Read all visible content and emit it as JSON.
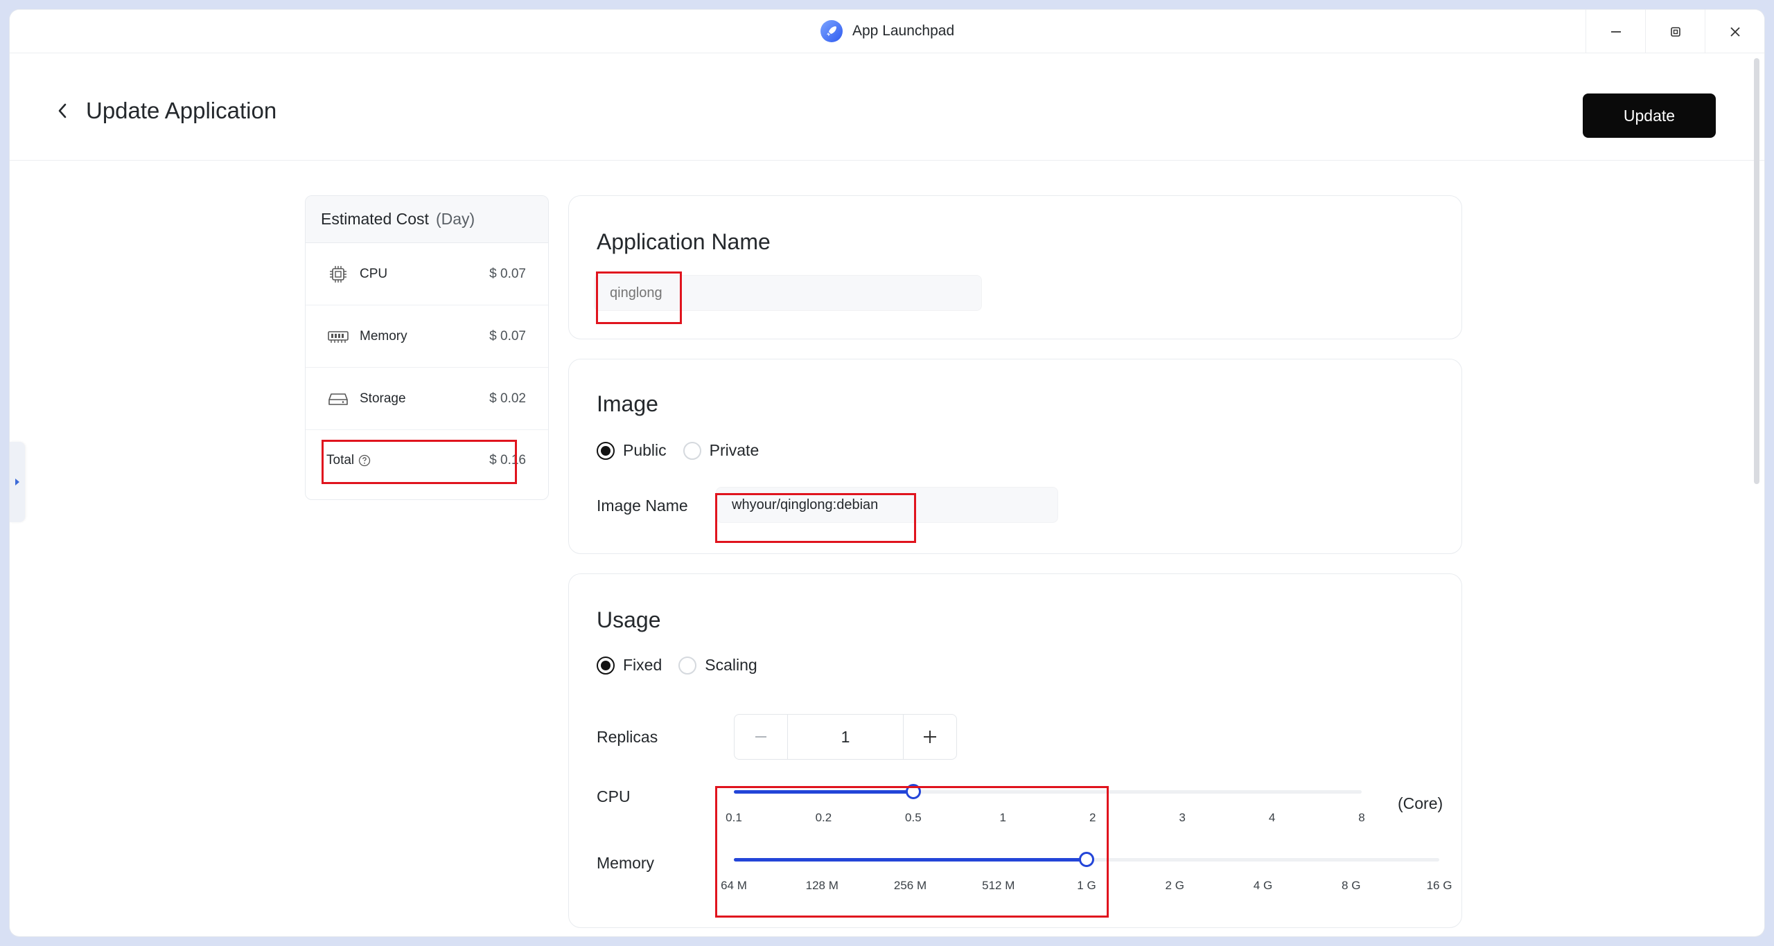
{
  "window": {
    "title": "App Launchpad",
    "minimize_icon": "minimize-icon",
    "restore_icon": "restore-icon",
    "close_icon": "close-icon"
  },
  "header": {
    "title": "Update Application",
    "update_label": "Update"
  },
  "cost": {
    "title": "Estimated Cost",
    "unit": "(Day)",
    "items": [
      {
        "label": "CPU",
        "value": "$ 0.07",
        "icon": "cpu-chip-icon"
      },
      {
        "label": "Memory",
        "value": "$ 0.07",
        "icon": "memory-module-icon"
      },
      {
        "label": "Storage",
        "value": "$ 0.02",
        "icon": "storage-drive-icon"
      }
    ],
    "total_label": "Total",
    "total_value": "$ 0.16"
  },
  "app_name": {
    "title": "Application Name",
    "placeholder": "qinglong",
    "value": ""
  },
  "image": {
    "title": "Image",
    "options": [
      "Public",
      "Private"
    ],
    "selected": "Public",
    "name_label": "Image Name",
    "name_value": "whyour/qinglong:debian"
  },
  "usage": {
    "title": "Usage",
    "options": [
      "Fixed",
      "Scaling"
    ],
    "selected": "Fixed",
    "replicas_label": "Replicas",
    "replicas_value": "1",
    "cpu": {
      "label": "CPU",
      "unit": "(Core)",
      "ticks": [
        "0.1",
        "0.2",
        "0.5",
        "1",
        "2",
        "3",
        "4",
        "8"
      ],
      "selected_index": 2
    },
    "memory": {
      "label": "Memory",
      "ticks": [
        "64 M",
        "128 M",
        "256 M",
        "512 M",
        "1 G",
        "2 G",
        "4 G",
        "8 G",
        "16 G"
      ],
      "selected_index": 4
    }
  },
  "colors": {
    "accent": "#2345d8",
    "highlight": "#e0141e",
    "primary_button": "#0a0a0a"
  }
}
